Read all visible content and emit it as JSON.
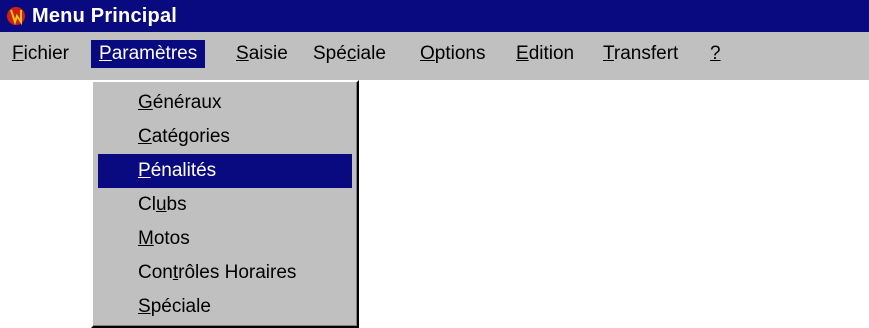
{
  "window": {
    "title": "Menu Principal",
    "icon": "app-logo-icon"
  },
  "menubar": [
    {
      "pre": "",
      "mn": "F",
      "post": "ichier",
      "name": "menu-fichier"
    },
    {
      "pre": "",
      "mn": "P",
      "post": "aramètres",
      "name": "menu-parametres",
      "active": true
    },
    {
      "pre": "",
      "mn": "S",
      "post": "aisie",
      "name": "menu-saisie"
    },
    {
      "pre": "Spé",
      "mn": "c",
      "post": "iale",
      "name": "menu-speciale"
    },
    {
      "pre": "",
      "mn": "O",
      "post": "ptions",
      "name": "menu-options"
    },
    {
      "pre": "",
      "mn": "E",
      "post": "dition",
      "name": "menu-edition"
    },
    {
      "pre": "",
      "mn": "T",
      "post": "ransfert",
      "name": "menu-transfert"
    },
    {
      "pre": "",
      "mn": "?",
      "post": "",
      "name": "menu-help"
    }
  ],
  "dropdown": [
    {
      "pre": "",
      "mn": "G",
      "post": "énéraux",
      "name": "dropdown-item-generaux"
    },
    {
      "pre": "",
      "mn": "C",
      "post": "atégories",
      "name": "dropdown-item-categories"
    },
    {
      "pre": "",
      "mn": "P",
      "post": "énalités",
      "name": "dropdown-item-penalites",
      "highlight": true
    },
    {
      "pre": "Cl",
      "mn": "u",
      "post": "bs",
      "name": "dropdown-item-clubs"
    },
    {
      "pre": "",
      "mn": "M",
      "post": "otos",
      "name": "dropdown-item-motos"
    },
    {
      "pre": "Con",
      "mn": "t",
      "post": "rôles Horaires",
      "name": "dropdown-item-controles-horaires"
    },
    {
      "pre": "",
      "mn": "S",
      "post": "péciale",
      "name": "dropdown-item-speciale"
    }
  ],
  "colors": {
    "titlebar": "#0a0a80",
    "menubar": "#c0c0c0",
    "highlight": "#0a0a80"
  }
}
